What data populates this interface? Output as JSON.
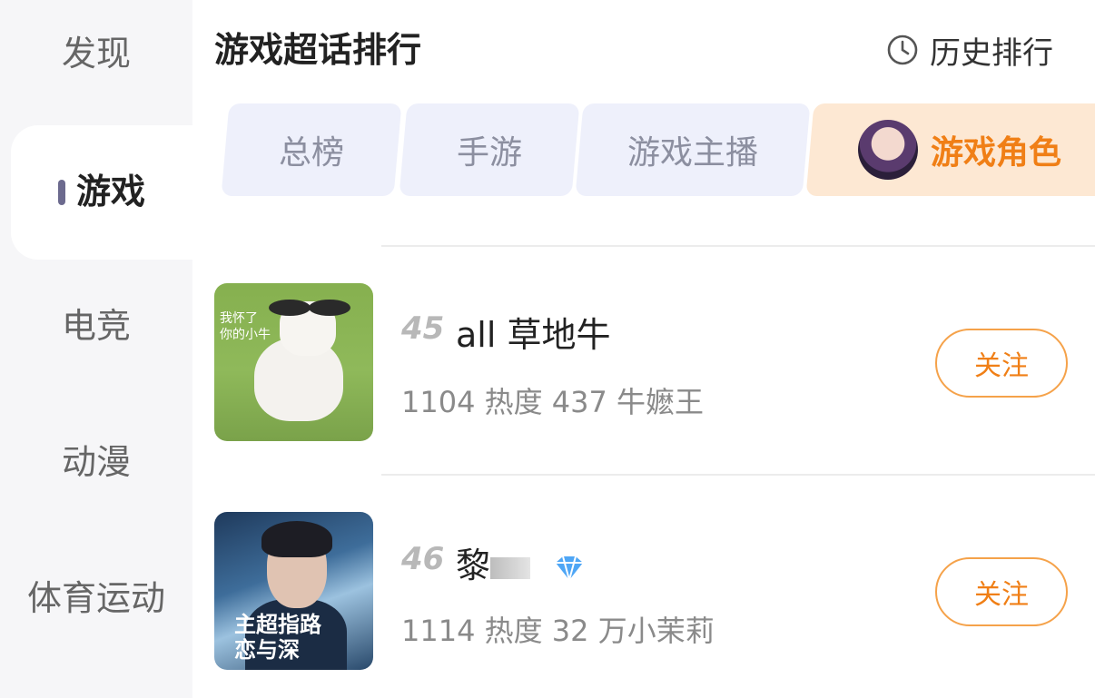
{
  "sidebar": {
    "items": [
      {
        "label": "发现",
        "active": false
      },
      {
        "label": "游戏",
        "active": true
      },
      {
        "label": "电竞",
        "active": false
      },
      {
        "label": "动漫",
        "active": false
      },
      {
        "label": "体育运动",
        "active": false
      }
    ]
  },
  "header": {
    "title": "游戏超话排行",
    "history_label": "历史排行",
    "history_icon": "clock-icon"
  },
  "tabs": [
    {
      "label": "总榜",
      "active": false
    },
    {
      "label": "手游",
      "active": false
    },
    {
      "label": "游戏主播",
      "active": false
    },
    {
      "label": "游戏角色",
      "active": true
    }
  ],
  "list": [
    {
      "rank": "45",
      "name": "all 草地牛",
      "heat": "1104 热度",
      "fans": "437 牛嬷王",
      "thumb_text": "我怀了\n你的小牛",
      "follow_label": "关注"
    },
    {
      "rank": "46",
      "name": "黎",
      "heat": "1114 热度",
      "fans": "32 万小茉莉",
      "thumb_text": "主超指路\n恋与深",
      "follow_label": "关注",
      "badge_icon": "diamond-icon"
    }
  ],
  "colors": {
    "accent": "#f07f16",
    "sidebar_bg": "#f6f6f8",
    "tab_bg": "#eef0fb",
    "active_tab_bg": "#fde8d3"
  }
}
